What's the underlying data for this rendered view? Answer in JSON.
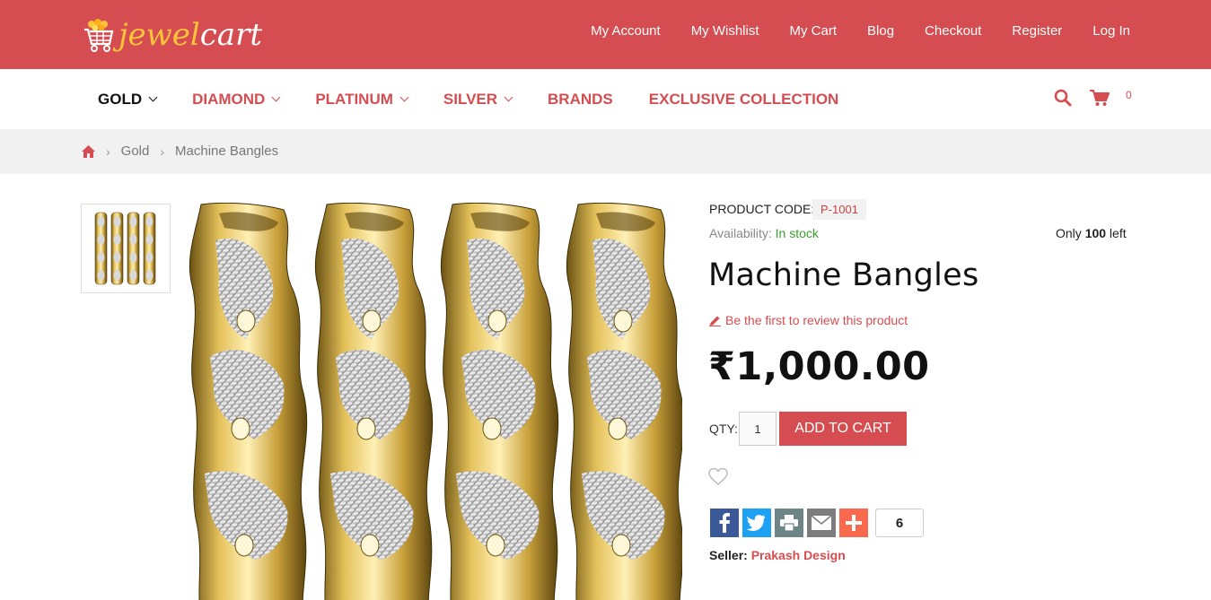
{
  "logo": {
    "text_a": "jewel",
    "text_b": "cart"
  },
  "top_links": [
    "My Account",
    "My Wishlist",
    "My Cart",
    "Blog",
    "Checkout",
    "Register",
    "Log In"
  ],
  "nav": {
    "items": [
      {
        "label": "GOLD",
        "dropdown": true,
        "active": true
      },
      {
        "label": "DIAMOND",
        "dropdown": true,
        "active": false
      },
      {
        "label": "PLATINUM",
        "dropdown": true,
        "active": false
      },
      {
        "label": "SILVER",
        "dropdown": true,
        "active": false
      },
      {
        "label": "BRANDS",
        "dropdown": false,
        "active": false
      },
      {
        "label": "EXCLUSIVE COLLECTION",
        "dropdown": false,
        "active": false
      }
    ],
    "cart_count": "0",
    "icons": [
      "search-icon",
      "cart-icon"
    ]
  },
  "breadcrumb": {
    "home_icon": "home-icon",
    "items": [
      "Gold",
      "Machine Bangles"
    ]
  },
  "product": {
    "code_label": "PRODUCT CODE:",
    "code": "P-1001",
    "availability_label": "Availability:",
    "availability": "In stock",
    "only_prefix": "Only ",
    "only_count": "100",
    "only_suffix": " left",
    "name": "Machine Bangles",
    "review_text": "Be the first to review this product",
    "price": "₹1,000.00",
    "qty_label": "QTY:",
    "qty_value": "1",
    "add_to_cart": "ADD TO CART",
    "share_count": "6",
    "seller_label": "Seller:",
    "seller_name": "Prakash Design"
  },
  "colors": {
    "brand_red": "#d54d50",
    "logo_yellow": "#ffc53a",
    "in_stock_green": "#3aa02c",
    "facebook": "#3b5998",
    "twitter": "#1da1f2",
    "print": "#6d8587",
    "email": "#7d7d7d",
    "addthis": "#f8694d"
  }
}
